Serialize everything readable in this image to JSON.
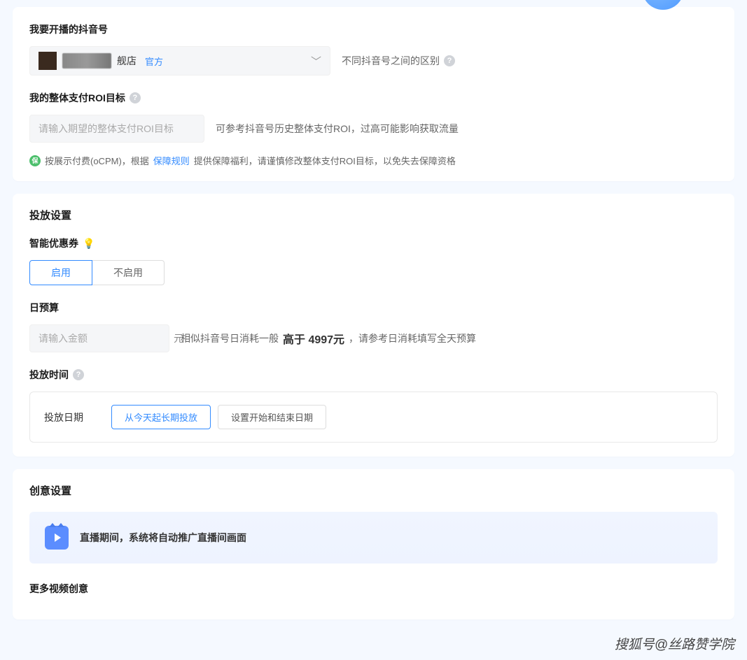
{
  "account": {
    "label": "我要开播的抖音号",
    "store_suffix": "舰店",
    "official_tag": "官方",
    "diff_hint": "不同抖音号之间的区别"
  },
  "roi": {
    "label": "我的整体支付ROI目标",
    "placeholder": "请输入期望的整体支付ROI目标",
    "hint": "可参考抖音号历史整体支付ROI，过高可能影响获取流量",
    "guarantee_badge": "保",
    "guarantee_prefix": "按展示付费(oCPM)，根据",
    "guarantee_link": "保障规则",
    "guarantee_suffix": "提供保障福利，请谨慎修改整体支付ROI目标，以免失去保障资格"
  },
  "delivery": {
    "title": "投放设置",
    "coupon_label": "智能优惠券",
    "enable": "启用",
    "disable": "不启用",
    "budget_label": "日预算",
    "budget_placeholder": "请输入金额",
    "budget_unit": "元",
    "budget_hint_prefix": "相似抖音号日消耗一般",
    "budget_hint_mid": "高于 4997元",
    "budget_hint_suffix": "，请参考日消耗填写全天预算",
    "schedule_label": "投放时间",
    "schedule_row_label": "投放日期",
    "schedule_option_long": "从今天起长期投放",
    "schedule_option_range": "设置开始和结束日期"
  },
  "creative": {
    "title": "创意设置",
    "banner_text": "直播期间，系统将自动推广直播间画面",
    "more_label": "更多视频创意"
  },
  "watermark": "搜狐号@丝路赞学院"
}
